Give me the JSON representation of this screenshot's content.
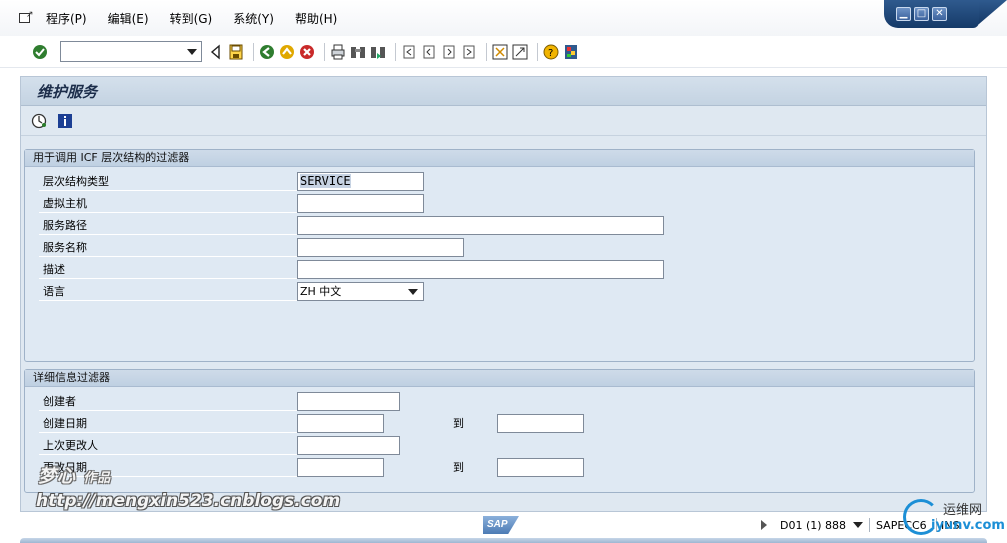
{
  "menu": {
    "items": [
      "程序(P)",
      "编辑(E)",
      "转到(G)",
      "系统(Y)",
      "帮助(H)"
    ]
  },
  "window_controls": {
    "minimize": "▁",
    "maximize": "□",
    "close": "✕"
  },
  "toolbar": {
    "command_field_value": "",
    "icons": [
      "enter-icon",
      "back-triangle-icon",
      "save-icon",
      "back-icon",
      "exit-icon",
      "cancel-icon",
      "print-icon",
      "find-icon",
      "find-next-icon",
      "first-page-icon",
      "previous-page-icon",
      "next-page-icon",
      "last-page-icon",
      "create-session-icon",
      "shortcut-icon",
      "help-icon",
      "customize-layout-icon"
    ]
  },
  "page": {
    "title": "维护服务",
    "app_icons": [
      "execute-icon",
      "info-icon"
    ]
  },
  "icf_filter": {
    "title": "用于调用 ICF 层次结构的过滤器",
    "fields": [
      {
        "label": "层次结构类型",
        "value": "SERVICE"
      },
      {
        "label": "虚拟主机",
        "value": ""
      },
      {
        "label": "服务路径",
        "value": ""
      },
      {
        "label": "服务名称",
        "value": ""
      },
      {
        "label": "描述",
        "value": ""
      },
      {
        "label": "语言",
        "value": "ZH 中文"
      }
    ]
  },
  "detail_filter": {
    "title": "详细信息过滤器",
    "fields": [
      {
        "label": "创建者",
        "value": ""
      },
      {
        "label": "创建日期",
        "value": "",
        "to_label": "到",
        "to_value": ""
      },
      {
        "label": "上次更改人",
        "value": ""
      },
      {
        "label": "更改日期",
        "value": "",
        "to_label": "到",
        "to_value": ""
      }
    ]
  },
  "status": {
    "logo": "SAP",
    "system": "D01 (1) 888",
    "server": "SAPECC6",
    "mode": "INS"
  },
  "watermarks": {
    "author": "梦心",
    "author_suffix": "作品",
    "url": "http://mengxin523.cnblogs.com",
    "site_cn": "运维网",
    "site_url": "iyunv.com"
  },
  "colors": {
    "accent": "#153a68",
    "panel": "#dfe9f3",
    "title_text": "#1c2d4a"
  }
}
